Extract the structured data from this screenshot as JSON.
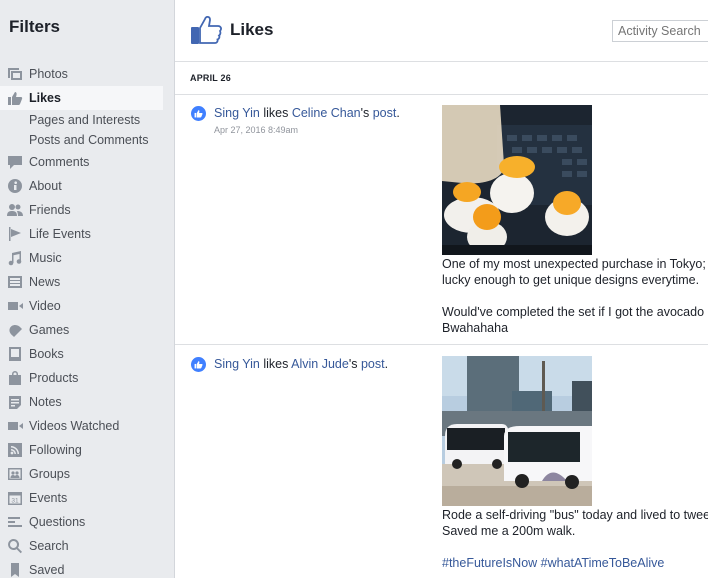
{
  "sidebar": {
    "title": "Filters",
    "items": [
      {
        "label": "Photos",
        "icon": "photos-icon"
      },
      {
        "label": "Likes",
        "icon": "like-icon",
        "active": true
      },
      {
        "label": "Comments",
        "icon": "comment-icon"
      },
      {
        "label": "About",
        "icon": "info-icon"
      },
      {
        "label": "Friends",
        "icon": "friends-icon"
      },
      {
        "label": "Life Events",
        "icon": "flag-icon"
      },
      {
        "label": "Music",
        "icon": "music-note-icon"
      },
      {
        "label": "News",
        "icon": "news-icon"
      },
      {
        "label": "Video",
        "icon": "video-camera-icon"
      },
      {
        "label": "Games",
        "icon": "gamepad-icon"
      },
      {
        "label": "Books",
        "icon": "book-icon"
      },
      {
        "label": "Products",
        "icon": "shopping-bag-icon"
      },
      {
        "label": "Notes",
        "icon": "notes-icon"
      },
      {
        "label": "Videos Watched",
        "icon": "video-camera-icon"
      },
      {
        "label": "Following",
        "icon": "rss-icon"
      },
      {
        "label": "Groups",
        "icon": "groups-icon"
      },
      {
        "label": "Events",
        "icon": "calendar-icon"
      },
      {
        "label": "Questions",
        "icon": "questions-icon"
      },
      {
        "label": "Search",
        "icon": "search-icon"
      },
      {
        "label": "Saved",
        "icon": "bookmark-icon"
      }
    ],
    "likes_subitems": [
      "Pages and Interests",
      "Posts and Comments"
    ]
  },
  "header": {
    "title": "Likes",
    "search_placeholder": "Activity Search"
  },
  "date_group": "APRIL 26",
  "stories": [
    {
      "actor": "Sing Yin",
      "verb": " likes ",
      "target": "Celine Chan",
      "possessive": "'s ",
      "object": "post",
      "period": ".",
      "timestamp": "Apr 27, 2016 8:49am",
      "image_alt": "Gudetama egg toys on a laptop keyboard",
      "text_lines": [
        "One of my most unexpected purchase in Tokyo; I",
        "lucky enough to get unique designs everytime."
      ],
      "text_lines_2": [
        "Would've completed the set if I got the avocado or",
        "Bwahahaha"
      ]
    },
    {
      "actor": "Sing Yin",
      "verb": " likes ",
      "target": "Alvin Jude",
      "possessive": "'s ",
      "object": "post",
      "period": ".",
      "timestamp": "",
      "image_alt": "Self-driving shuttle buses on a city street",
      "text_lines": [
        "Rode a self-driving \"bus\" today and lived to tweet",
        "Saved me a 200m walk."
      ],
      "hashtags": [
        "#theFutureIsNow",
        "#whatATimeToBeAlive"
      ]
    }
  ],
  "colors": {
    "link": "#365899",
    "like_badge": "#4080ff",
    "sidebar_bg": "#e9ebee"
  }
}
